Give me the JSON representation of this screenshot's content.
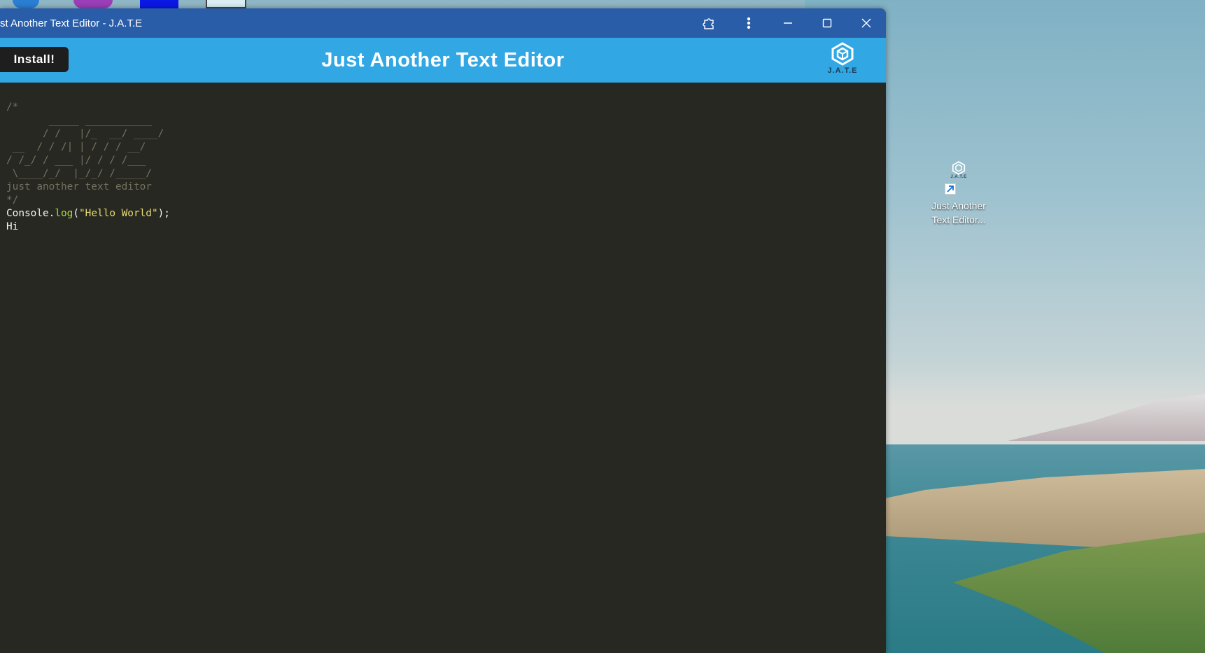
{
  "window": {
    "title": "st Another Text Editor - J.A.T.E",
    "controls": {
      "extensions_icon": "puzzle-icon",
      "menu_icon": "more-vertical-icon",
      "minimize_icon": "minimize-icon",
      "maximize_icon": "maximize-icon",
      "close_icon": "close-icon"
    }
  },
  "header": {
    "install_label": "Install!",
    "title": "Just Another Text Editor",
    "logo_text": "J.A.T.E"
  },
  "editor": {
    "lines": {
      "l1": "/*",
      "l2": "       _____ ___________",
      "l3": "      / /   |/_  __/ ____/",
      "l4": " __  / / /| | / / / __/",
      "l5": "/ /_/ / ___ |/ / / /___",
      "l6": " \\____/_/  |_/_/ /_____/",
      "l7": "just another text editor",
      "l8": "*/",
      "l9_obj": "Console",
      "l9_dot": ".",
      "l9_fn": "log",
      "l9_open": "(",
      "l9_str": "\"Hello World\"",
      "l9_close": ");",
      "l10": "Hi"
    }
  },
  "desktop": {
    "shortcut_label_1": "Just Another",
    "shortcut_label_2": "Text Editor...",
    "shortcut_icon_text": "J.A.T.E"
  },
  "colors": {
    "titlebar": "#2a5da8",
    "header": "#31a7e4",
    "editor_bg": "#272822"
  }
}
